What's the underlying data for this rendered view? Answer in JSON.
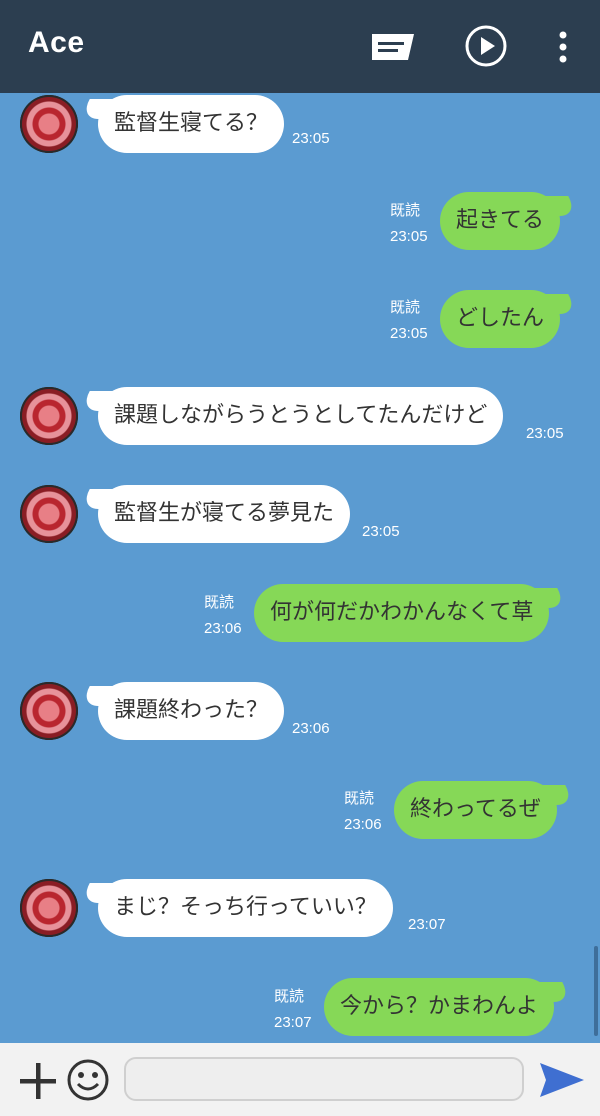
{
  "header": {
    "title": "Ace",
    "icons": [
      "keep-icon",
      "play-icon",
      "more-icon"
    ]
  },
  "messages": [
    {
      "side": "in",
      "text": "監督生寝てる？",
      "time": "23:05"
    },
    {
      "side": "out",
      "text": "起きてる",
      "read": "既読",
      "time": "23:05"
    },
    {
      "side": "out",
      "text": "どしたん",
      "read": "既読",
      "time": "23:05"
    },
    {
      "side": "in",
      "text": "課題しながらうとうとしてたんだけど",
      "time": "23:05"
    },
    {
      "side": "in",
      "text": "監督生が寝てる夢見た",
      "time": "23:05"
    },
    {
      "side": "out",
      "text": "何が何だかわかんなくて草",
      "read": "既読",
      "time": "23:06"
    },
    {
      "side": "in",
      "text": "課題終わった？",
      "time": "23:06"
    },
    {
      "side": "out",
      "text": "終わってるぜ",
      "read": "既読",
      "time": "23:06"
    },
    {
      "side": "in",
      "text": "まじ？そっち行っていい？",
      "time": "23:07"
    },
    {
      "side": "out",
      "text": "今から？かまわんよ",
      "read": "既読",
      "time": "23:07"
    }
  ],
  "input": {
    "placeholder": "",
    "icons": [
      "plus-icon",
      "emoji-icon",
      "send-icon"
    ]
  },
  "colors": {
    "header_bg": "#2c3e50",
    "chat_bg": "#5b9bd1",
    "incoming_bubble": "#ffffff",
    "outgoing_bubble": "#86d857",
    "send_accent": "#3f6fd1"
  }
}
